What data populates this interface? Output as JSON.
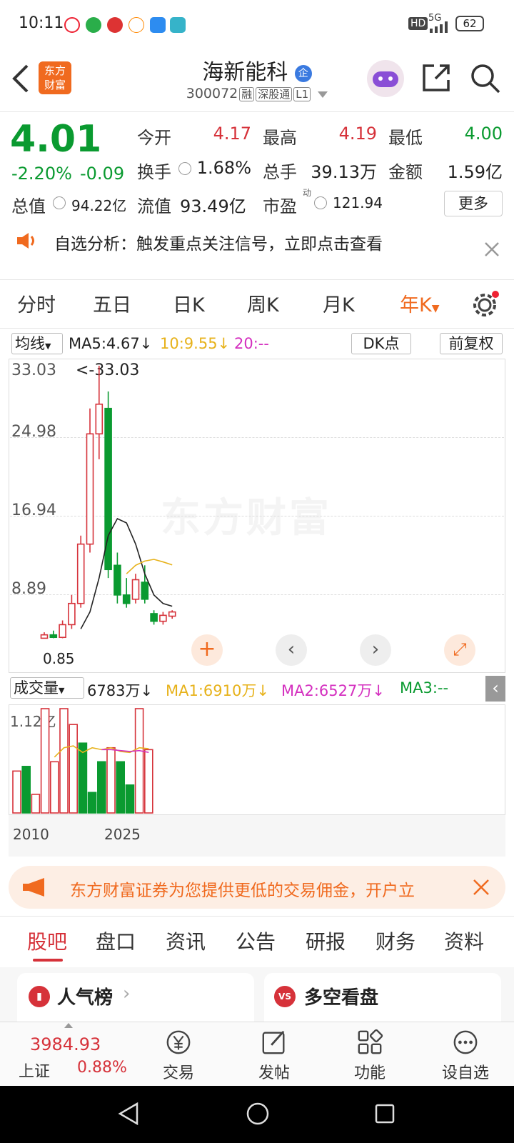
{
  "status": {
    "time": "10:11",
    "battery": "62",
    "network": "5G",
    "hd": "HD"
  },
  "header": {
    "title": "海新能科",
    "code": "300072",
    "tags": [
      "融",
      "深股通",
      "L1"
    ],
    "logo_line1": "东方",
    "logo_line2": "财富",
    "badge": "企"
  },
  "quote": {
    "price": "4.01",
    "change_pct": "-2.20%",
    "change": "-0.09",
    "open_label": "今开",
    "open": "4.17",
    "high_label": "最高",
    "high": "4.19",
    "low_label": "最低",
    "low": "4.00",
    "turnover_label": "换手",
    "turnover": "1.68%",
    "volume_label": "总手",
    "volume": "39.13万",
    "amount_label": "金额",
    "amount": "1.59亿",
    "mktcap_label": "总值",
    "mktcap": "94.22亿",
    "float_label": "流值",
    "float": "93.49亿",
    "pe_label": "市盈",
    "pe_sup": "动",
    "pe": "121.94",
    "more": "更多"
  },
  "notice": {
    "text": "自选分析：触发重点关注信号，立即点击查看"
  },
  "ktabs": [
    "分时",
    "五日",
    "日K",
    "周K",
    "月K",
    "年K"
  ],
  "ma_bar": {
    "select": "均线",
    "ma5": "MA5:4.67↓",
    "ma10": "10:9.55↓",
    "ma20": "20:--",
    "dk": "DK点",
    "fq": "前复权"
  },
  "price_axis": [
    "33.03",
    "24.98",
    "16.94",
    "8.89"
  ],
  "max_label": "<-33.03",
  "min_label": "0.85",
  "vol_bar": {
    "select": "成交量",
    "vol": "6783万↓",
    "ma1": "MA1:6910万↓",
    "ma2": "MA2:6527万↓",
    "ma3": "MA3:--"
  },
  "vol_axis": "1.12亿",
  "x_axis": [
    "2010",
    "2025"
  ],
  "watermark": "东方财富",
  "ad": {
    "text": "东方财富证券为您提供更低的交易佣金，开户立"
  },
  "bottom_tabs": [
    "股吧",
    "盘口",
    "资讯",
    "公告",
    "研报",
    "财务",
    "资料"
  ],
  "cards": {
    "left": "人气榜",
    "right": "多空看盘"
  },
  "nav": {
    "index_value": "3984.93",
    "index_name": "上证",
    "index_pct": "0.88%",
    "items": [
      "交易",
      "发帖",
      "功能",
      "设自选"
    ]
  },
  "colors": {
    "up": "#d6323a",
    "down": "#0a9a30",
    "accent": "#f06a1f",
    "ma10": "#e7b21b",
    "ma20": "#d42fbf"
  },
  "chart_data": {
    "type": "candlestick",
    "candles": [
      {
        "o": 0.9,
        "h": 1.6,
        "l": 0.85,
        "c": 1.3
      },
      {
        "o": 1.3,
        "h": 1.8,
        "l": 0.9,
        "c": 1.0
      },
      {
        "o": 1.0,
        "h": 3.0,
        "l": 0.9,
        "c": 2.5
      },
      {
        "o": 2.5,
        "h": 6.0,
        "l": 2.0,
        "c": 5.0
      },
      {
        "o": 5.0,
        "h": 13.0,
        "l": 4.5,
        "c": 12.0
      },
      {
        "o": 12.0,
        "h": 28.0,
        "l": 11.0,
        "c": 25.0
      },
      {
        "o": 25.0,
        "h": 33.03,
        "l": 22.0,
        "c": 28.5
      },
      {
        "o": 28.0,
        "h": 30.0,
        "l": 8.0,
        "c": 9.0
      },
      {
        "o": 9.5,
        "h": 11.0,
        "l": 5.0,
        "c": 6.0
      },
      {
        "o": 6.0,
        "h": 8.0,
        "l": 4.5,
        "c": 5.0
      },
      {
        "o": 5.5,
        "h": 8.5,
        "l": 5.0,
        "c": 7.8
      },
      {
        "o": 7.5,
        "h": 9.5,
        "l": 5.0,
        "c": 5.5
      },
      {
        "o": 3.8,
        "h": 4.2,
        "l": 2.5,
        "c": 2.9
      },
      {
        "o": 2.9,
        "h": 4.0,
        "l": 2.5,
        "c": 3.6
      },
      {
        "o": 3.5,
        "h": 4.2,
        "l": 3.2,
        "c": 4.0
      }
    ],
    "ma5": [
      null,
      null,
      null,
      null,
      2.0,
      4.0,
      8.0,
      13.0,
      15.0,
      14.5,
      12.0,
      8.5,
      6.0,
      5.0,
      4.67
    ],
    "ma10": [
      null,
      null,
      null,
      null,
      null,
      null,
      null,
      null,
      null,
      8.5,
      9.5,
      10.0,
      10.2,
      9.9,
      9.55
    ],
    "volumes": [
      0.45,
      0.5,
      0.2,
      1.12,
      0.55,
      1.12,
      0.95,
      0.75,
      0.22,
      0.55,
      0.7,
      0.55,
      0.3,
      1.12,
      0.68
    ],
    "vol_ma1": [
      null,
      null,
      null,
      null,
      0.6,
      0.7,
      0.72,
      0.65,
      0.7,
      0.68,
      0.7,
      0.66,
      0.65,
      0.7,
      0.69
    ],
    "vol_ma2": [
      null,
      null,
      null,
      null,
      null,
      null,
      null,
      null,
      null,
      0.68,
      0.68,
      0.67,
      0.66,
      0.67,
      0.65
    ]
  }
}
